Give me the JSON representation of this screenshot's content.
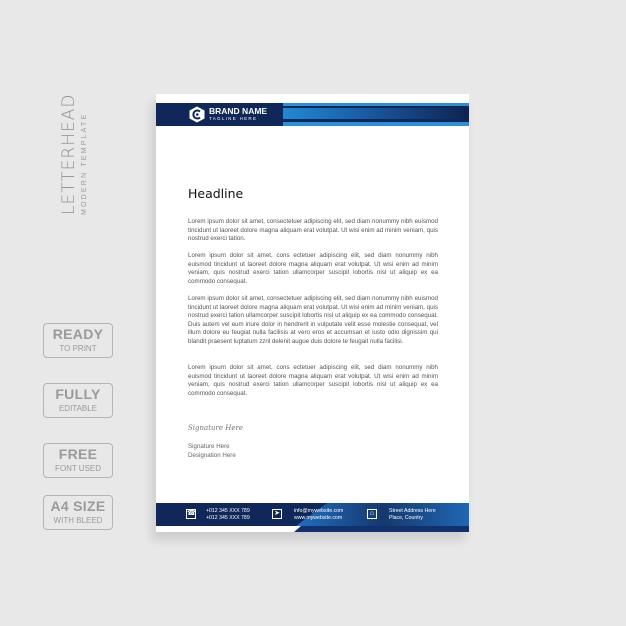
{
  "side": {
    "title": "LETTERHEAD",
    "subtitle": "MODERN TEMPLATE",
    "badges": [
      {
        "line1": "READY",
        "line2": "TO PRINT"
      },
      {
        "line1": "FULLY",
        "line2": "EDITABLE"
      },
      {
        "line1": "FREE",
        "line2": "FONT USED"
      },
      {
        "line1": "A4 SIZE",
        "line2": "WITH BLEED"
      }
    ]
  },
  "letterhead": {
    "brand_name": "BRAND NAME",
    "tagline": "TAGLINE HERE",
    "logo_icon": "hexagon-c-logo",
    "headline": "Headline",
    "paragraphs": [
      "Lorem ipsum dolor sit amet, consectetuer adipiscing elit, sed diam nonummy nibh euismod tincidunt ut laoreet dolore magna aliquam erat volutpat. Ut wisi enim ad minim veniam, quis nostrud exerci tation.",
      "Lorem ipsum dolor sit amet, cons ectetuer adipiscing elit, sed diam nonummy nibh euismod tincidunt ut laoreet dolore magna aliquam erat volutpat. Ut wisi enim ad minim veniam, quis nostrud exerci tation ullamcorper suscipit lobortis nisl ut aliquip ex ea commodo consequat.",
      "Lorem ipsum dolor sit amet, consectetuer adipiscing elit, sed diam nonummy nibh euismod tincidunt ut laoreet dolore magna aliquam erat volutpat. Ut wisi enim ad minim veniam, quis nostrud exerci tation ullamcorper suscipit lobortis nisl ut aliquip ex ea commodo consequat. Duis autem vel eum iriure dolor in hendrerit in vulputate velit esse molestie consequat, vel illum dolore eu feugiat nulla facilisis at vero eros et accumsan et iusto odio dignissim qui blandit praesent luptatum zzril delenit augue duis dolore te feugait nulla facilisi.",
      "Lorem ipsum dolor sit amet, cons ectetuer adipiscing elit, sed diam nonummy nibh euismod tincidunt ut laoreet dolore magna aliquam erat volutpat. Ut wisi enim ad minim veniam, quis nostrud exerci tation ullamcorper suscipit lobortis nisl ut aliquip ex ea commodo consequat."
    ],
    "signature_script": "Signature Here",
    "signature_name": "Signature Here",
    "designation": "Designation Here",
    "footer": {
      "phone1": "+012 345 XXX 789",
      "phone2": "+012 345 XXX 789",
      "email": "info@mywebsite.com",
      "website": "www.mywebsite.com",
      "address1": "Street Address Here",
      "address2": "Place, Country",
      "phone_icon": "☎",
      "web_icon": "➤",
      "home_icon": "⌂"
    }
  },
  "colors": {
    "navy": "#10275a",
    "blue": "#1f8ad3",
    "background": "#e8e8e8"
  }
}
